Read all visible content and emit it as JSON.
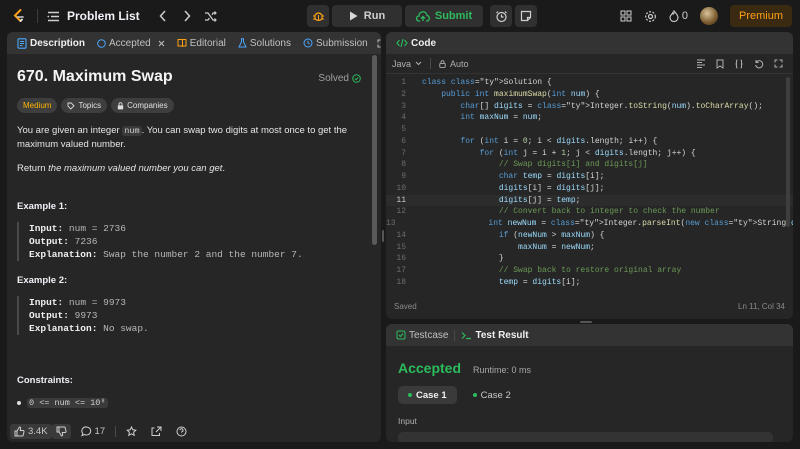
{
  "topbar": {
    "problem_list": "Problem List",
    "run": "Run",
    "submit": "Submit",
    "streak": "0",
    "premium": "Premium"
  },
  "left_tabs": [
    {
      "label": "Description",
      "icon": "description-icon"
    },
    {
      "label": "Accepted",
      "icon": "check-circle-icon"
    },
    {
      "label": "Editorial",
      "icon": "book-icon"
    },
    {
      "label": "Solutions",
      "icon": "flask-icon"
    },
    {
      "label": "Submission",
      "icon": "history-icon"
    }
  ],
  "problem": {
    "title": "670. Maximum Swap",
    "status": "Solved",
    "difficulty": "Medium",
    "topics": "Topics",
    "companies": "Companies",
    "desc_1a": "You are given an integer ",
    "desc_1code": "num",
    "desc_1b": ". You can swap two digits at most once to get the maximum valued number.",
    "desc_2a": "Return ",
    "desc_2em": "the maximum valued number you can get",
    "desc_2b": ".",
    "ex1_title": "Example 1:",
    "ex1_input_k": "Input:",
    "ex1_input_v": " num = 2736",
    "ex1_output_k": "Output:",
    "ex1_output_v": " 7236",
    "ex1_expl_k": "Explanation:",
    "ex1_expl_v": " Swap the number 2 and the number 7.",
    "ex2_title": "Example 2:",
    "ex2_input_k": "Input:",
    "ex2_input_v": " num = 9973",
    "ex2_output_k": "Output:",
    "ex2_output_v": " 9973",
    "ex2_expl_k": "Explanation:",
    "ex2_expl_v": " No swap.",
    "constraints_title": "Constraints:",
    "constraint_1": "0 <= num <= 10⁸"
  },
  "footer": {
    "likes": "3.4K",
    "comments": "17"
  },
  "code": {
    "tab": "Code",
    "language": "Java",
    "mode": "Auto",
    "status": "Saved",
    "cursor": "Ln 11, Col 34",
    "lines": [
      "class Solution {",
      "    public int maximumSwap(int num) {",
      "        char[] digits = Integer.toString(num).toCharArray();",
      "        int maxNum = num;",
      "",
      "        for (int i = 0; i < digits.length; i++) {",
      "            for (int j = i + 1; j < digits.length; j++) {",
      "                // Swap digits[i] and digits[j]",
      "                char temp = digits[i];",
      "                digits[i] = digits[j];",
      "                digits[j] = temp;",
      "                // Convert back to integer to check the number",
      "                int newNum = Integer.parseInt(new String(digits));",
      "                if (newNum > maxNum) {",
      "                    maxNum = newNum;",
      "                }",
      "                // Swap back to restore original array",
      "                temp = digits[i];"
    ]
  },
  "test": {
    "tab_testcase": "Testcase",
    "tab_result": "Test Result",
    "verdict": "Accepted",
    "runtime": "Runtime: 0 ms",
    "case1": "Case 1",
    "case2": "Case 2",
    "input_label": "Input"
  },
  "colors": {
    "accent": "#ffa116",
    "success": "#2cbb5d",
    "panel": "#262626",
    "bg": "#1a1a1a"
  }
}
